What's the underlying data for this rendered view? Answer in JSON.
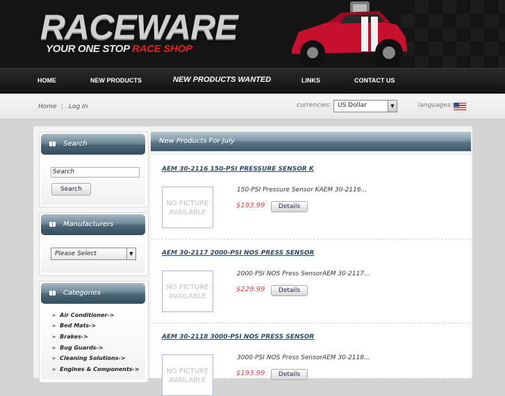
{
  "brand": {
    "logo_main": "RACEWARE",
    "logo_sub_a": "YOUR ONE STOP ",
    "logo_sub_b": "RACE SHOP",
    "accent_color": "#e02020"
  },
  "nav": {
    "items": [
      {
        "label": "HOME"
      },
      {
        "label": "NEW PRODUCTS"
      },
      {
        "label": "NEW PRODUCTS WANTED"
      },
      {
        "label": "LINKS"
      },
      {
        "label": "CONTACT US"
      }
    ]
  },
  "util": {
    "home": "Home",
    "sep": "|",
    "login": "Log In",
    "currencies_label": "currencies:",
    "currency_value": "US Dollar",
    "languages_label": "languages:"
  },
  "search": {
    "title": "Search",
    "input_value": "Search",
    "button": "Search"
  },
  "manufacturers": {
    "title": "Manufacturers",
    "selected": "Please Select"
  },
  "categories": {
    "title": "Categories",
    "items": [
      {
        "label": "Air Conditioner->"
      },
      {
        "label": "Bed Mats->"
      },
      {
        "label": "Brakes->"
      },
      {
        "label": "Bug Guards->"
      },
      {
        "label": "Cleaning Solutions->"
      },
      {
        "label": "Engines & Components->"
      }
    ]
  },
  "main": {
    "heading": "New Products For July",
    "no_picture": "NO PICTURE AVAILABLE",
    "details_label": "Details",
    "products": [
      {
        "title": "AEM 30-2116 150-PSI PRESSURE SENSOR K",
        "desc": "150-PSI Pressure Sensor KAEM 30-2116...",
        "price": "$193.99"
      },
      {
        "title": "AEM 30-2117 2000-PSI NOS PRESS SENSOR",
        "desc": "2000-PSI NOS Press SensorAEM 30-2117...",
        "price": "$229.99"
      },
      {
        "title": "AEM 30-2118 3000-PSI NOS PRESS SENSOR",
        "desc": "3000-PSI NOS Press SensorAEM 30-2118...",
        "price": "$193.99"
      }
    ]
  }
}
